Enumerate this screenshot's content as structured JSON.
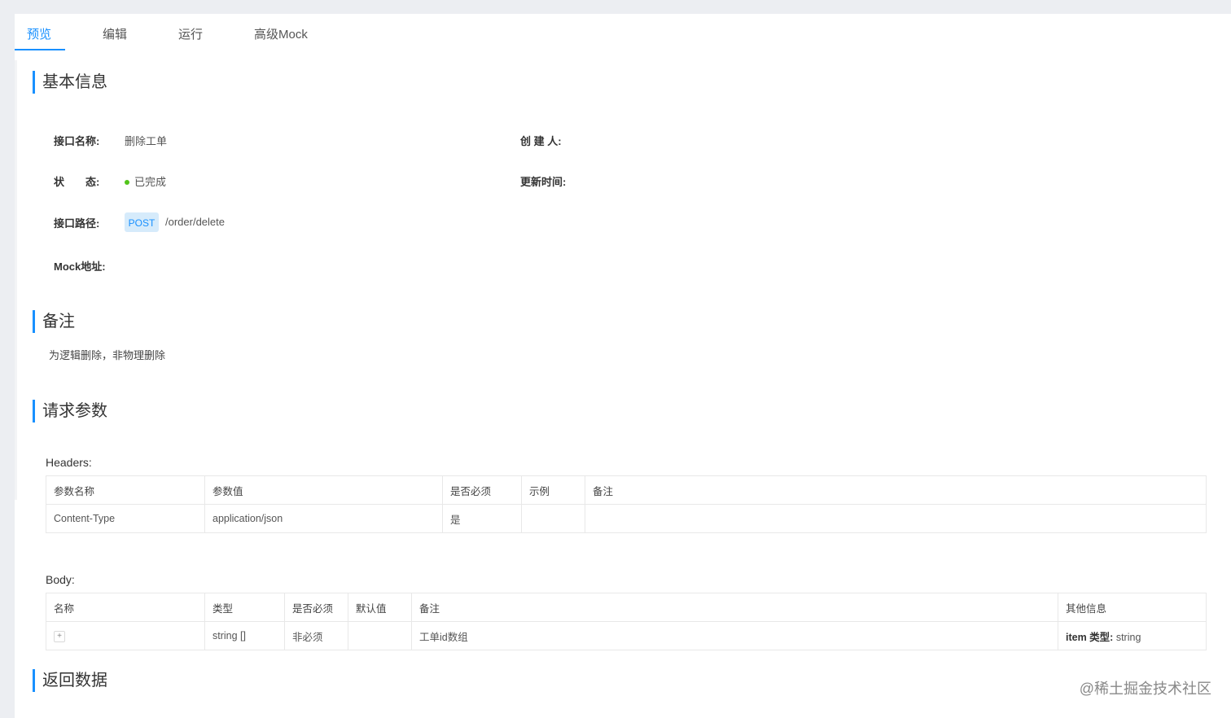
{
  "tabs": [
    {
      "label": "预览"
    },
    {
      "label": "编辑"
    },
    {
      "label": "运行"
    },
    {
      "label": "高级Mock"
    }
  ],
  "basic_info": {
    "title": "基本信息",
    "name_label": "接口名称:",
    "name_value": "删除工单",
    "creator_label": "创 建 人:",
    "status_label": "状　　态:",
    "status_value": "已完成",
    "update_label": "更新时间:",
    "path_label": "接口路径:",
    "method": "POST",
    "path": "/order/delete",
    "mock_label": "Mock地址:"
  },
  "remark": {
    "title": "备注",
    "text": "为逻辑删除，非物理删除"
  },
  "request": {
    "title": "请求参数",
    "headers_label": "Headers:",
    "headers_columns": [
      "参数名称",
      "参数值",
      "是否必须",
      "示例",
      "备注"
    ],
    "headers_rows": [
      [
        "Content-Type",
        "application/json",
        "是",
        "",
        ""
      ]
    ],
    "body_label": "Body:",
    "body_columns": [
      "名称",
      "类型",
      "是否必须",
      "默认值",
      "备注",
      "其他信息"
    ],
    "body_rows": [
      {
        "expand": "+",
        "type": "string []",
        "required": "非必须",
        "default": "",
        "remark": "工单id数组",
        "other_key": "item 类型:",
        "other_value": "string"
      }
    ]
  },
  "response": {
    "title": "返回数据"
  },
  "watermark": "@稀土掘金技术社区",
  "colors": {
    "accent": "#1890ff",
    "status_done": "#52c41a"
  }
}
